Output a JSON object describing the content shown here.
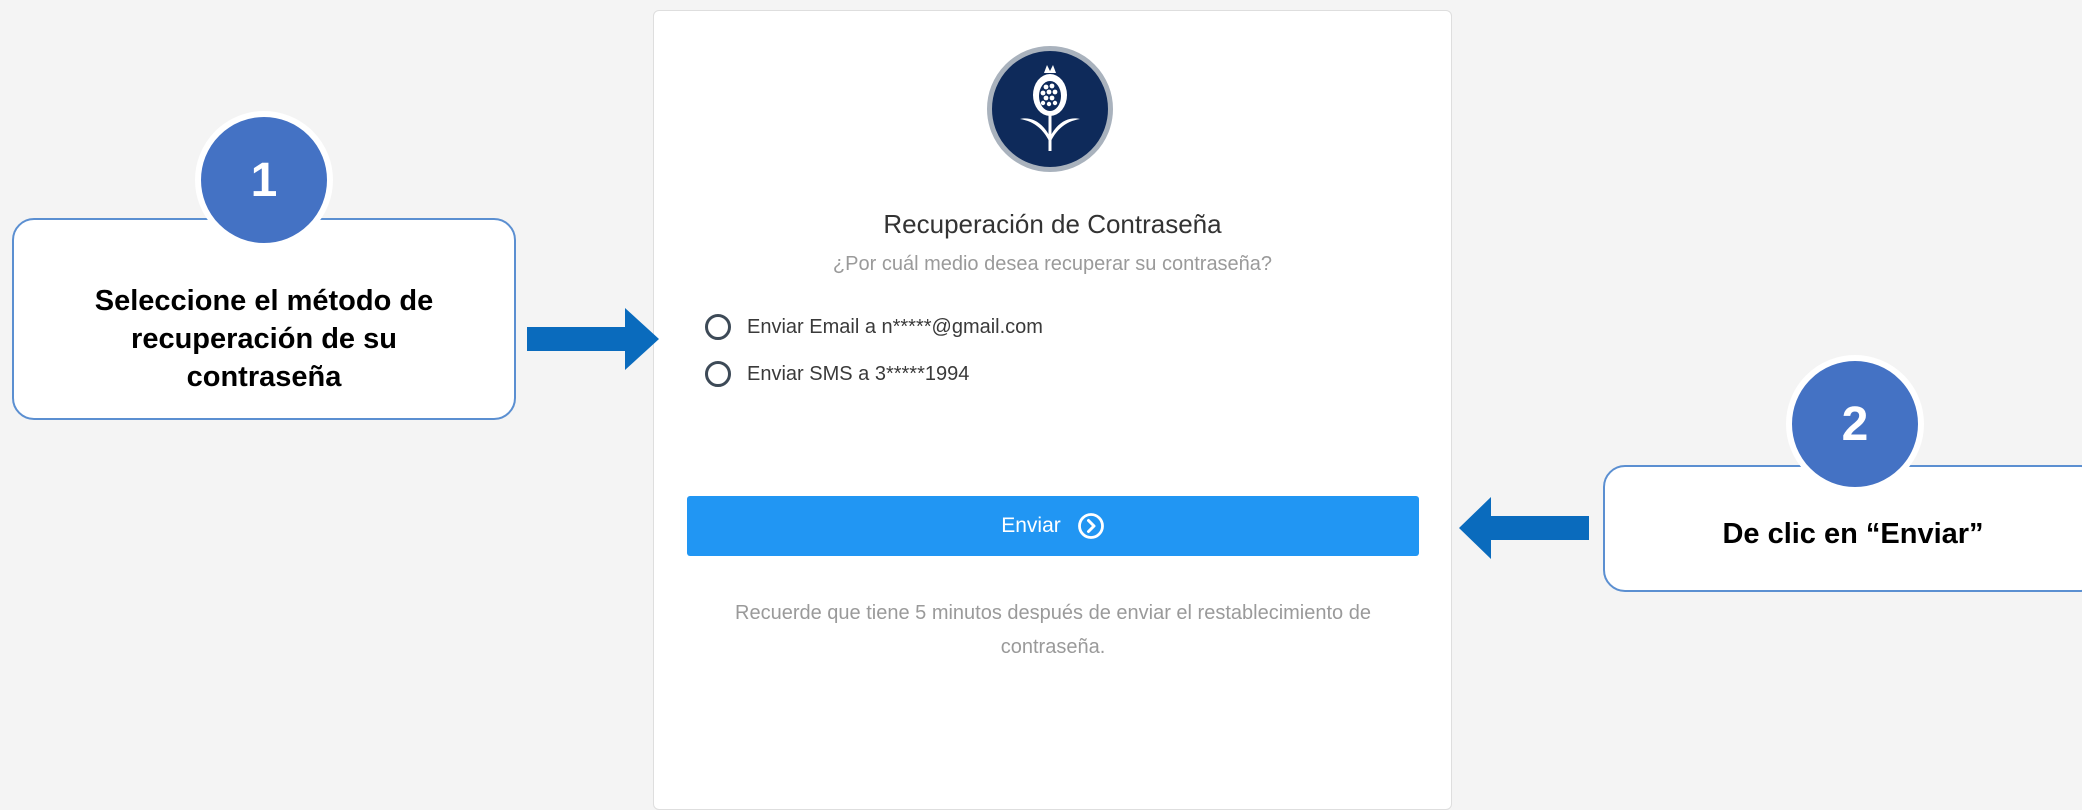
{
  "card": {
    "logo_icon": "pomegranate-flower-logo-icon",
    "title": "Recuperación de Contraseña",
    "subtitle": "¿Por cuál medio desea recuperar su contraseña?",
    "options": [
      {
        "label": "Enviar Email a n*****@gmail.com",
        "selected": false
      },
      {
        "label": "Enviar SMS a 3*****1994",
        "selected": false
      }
    ],
    "send_button": {
      "label": "Enviar",
      "icon": "chevron-right-circle-icon"
    },
    "note": "Recuerde que tiene 5 minutos después de enviar el restablecimiento de contraseña."
  },
  "callouts": [
    {
      "number": "1",
      "text": "Seleccione el método de recuperación de su contraseña"
    },
    {
      "number": "2",
      "text": "De clic en “Enviar”"
    }
  ],
  "colors": {
    "background": "#f4f4f4",
    "primary_button": "#2196f3",
    "badge": "#4472c4",
    "arrow": "#0a6bbd",
    "logo_bg": "#0e2a5a"
  }
}
